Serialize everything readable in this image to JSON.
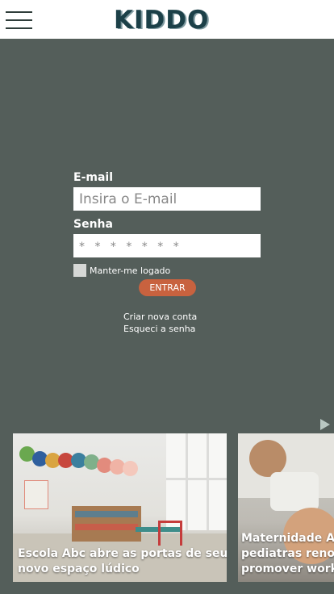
{
  "header": {
    "menu_icon": "hamburger-menu-icon",
    "logo": "KIDDO"
  },
  "login": {
    "email_label": "E-mail",
    "email_placeholder": "Insira o E-mail",
    "email_value": "",
    "password_label": "Senha",
    "password_placeholder": "* * * * * * *",
    "password_value": "",
    "remember_label": "Manter-me logado",
    "remember_checked": false,
    "submit_label": "ENTRAR",
    "create_account": "Criar nova conta",
    "forgot_password": "Esqueci a senha"
  },
  "news": {
    "next_icon": "play-arrow-icon",
    "cards": [
      {
        "title_line1": "Escola Abc abre as portas de seu",
        "title_line2": "novo espaço lúdico"
      },
      {
        "title_line1": "Maternidade ABC",
        "title_line2": "pediatras renom",
        "title_line3": "promover works"
      }
    ]
  },
  "colors": {
    "background": "#545e5a",
    "accent": "#c8623f",
    "logo": "#1c4048",
    "header": "#ffffff"
  }
}
